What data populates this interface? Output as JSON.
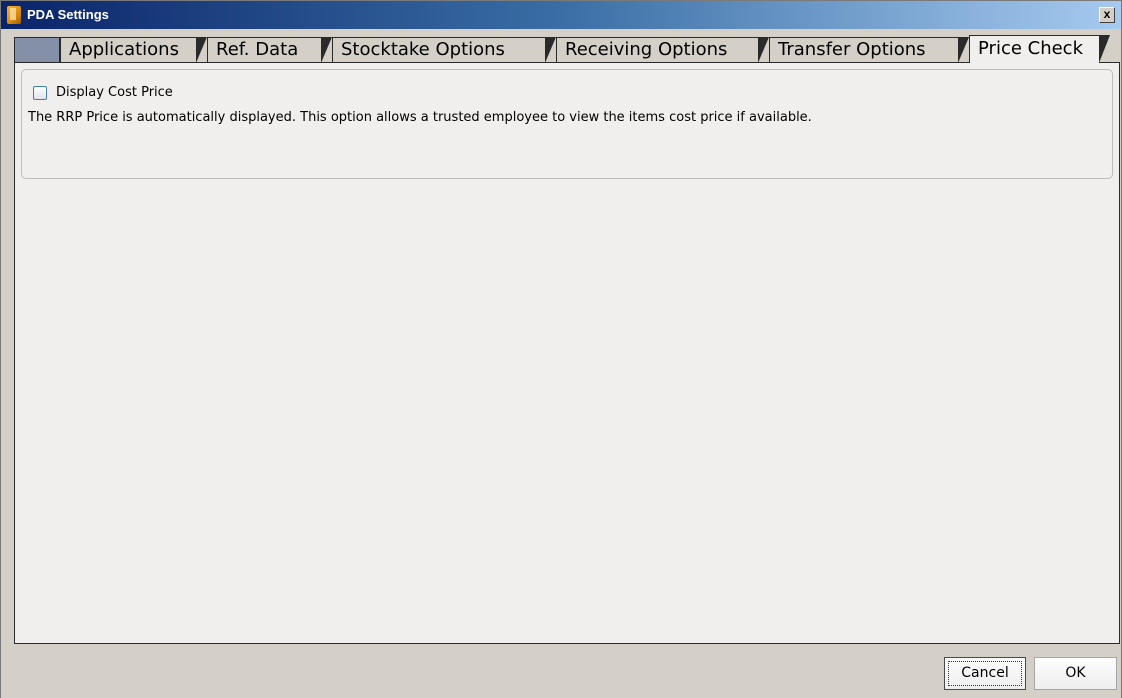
{
  "window": {
    "title": "PDA Settings",
    "close_label": "x",
    "icon": "app-icon"
  },
  "tabs": [
    {
      "label": "Applications",
      "active": false
    },
    {
      "label": "Ref. Data",
      "active": false
    },
    {
      "label": "Stocktake Options",
      "active": false
    },
    {
      "label": "Receiving Options",
      "active": false
    },
    {
      "label": "Transfer Options",
      "active": false
    },
    {
      "label": "Price Check",
      "active": true
    }
  ],
  "price_check": {
    "display_cost_price": {
      "label": "Display Cost Price",
      "checked": false
    },
    "description": "The RRP Price is automatically displayed.  This option allows a trusted employee to view the items cost price if available."
  },
  "buttons": {
    "cancel": "Cancel",
    "ok": "OK"
  },
  "colors": {
    "title_gradient_start": "#0a246a",
    "title_gradient_end": "#a6caf0",
    "panel": "#f1efed",
    "inactive_tab_lead": "#848fa8"
  }
}
